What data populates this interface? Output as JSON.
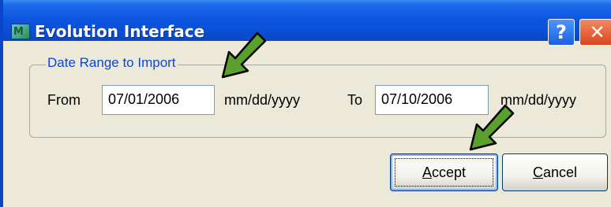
{
  "window": {
    "title": "Evolution Interface",
    "icon": "app-icon",
    "help_button": "?",
    "close_button": "✕"
  },
  "date_range": {
    "group_label": "Date Range to Import",
    "from_label": "From",
    "from_value": "07/01/2006",
    "from_format": "mm/dd/yyyy",
    "to_label": "To",
    "to_value": "07/10/2006",
    "to_format": "mm/dd/yyyy"
  },
  "buttons": {
    "accept_mnemonic": "A",
    "accept_rest": "ccept",
    "cancel_mnemonic": "C",
    "cancel_rest": "ancel"
  },
  "annotations": {
    "arrow_color": "#5aa02c",
    "arrow_outline": "#000000"
  }
}
